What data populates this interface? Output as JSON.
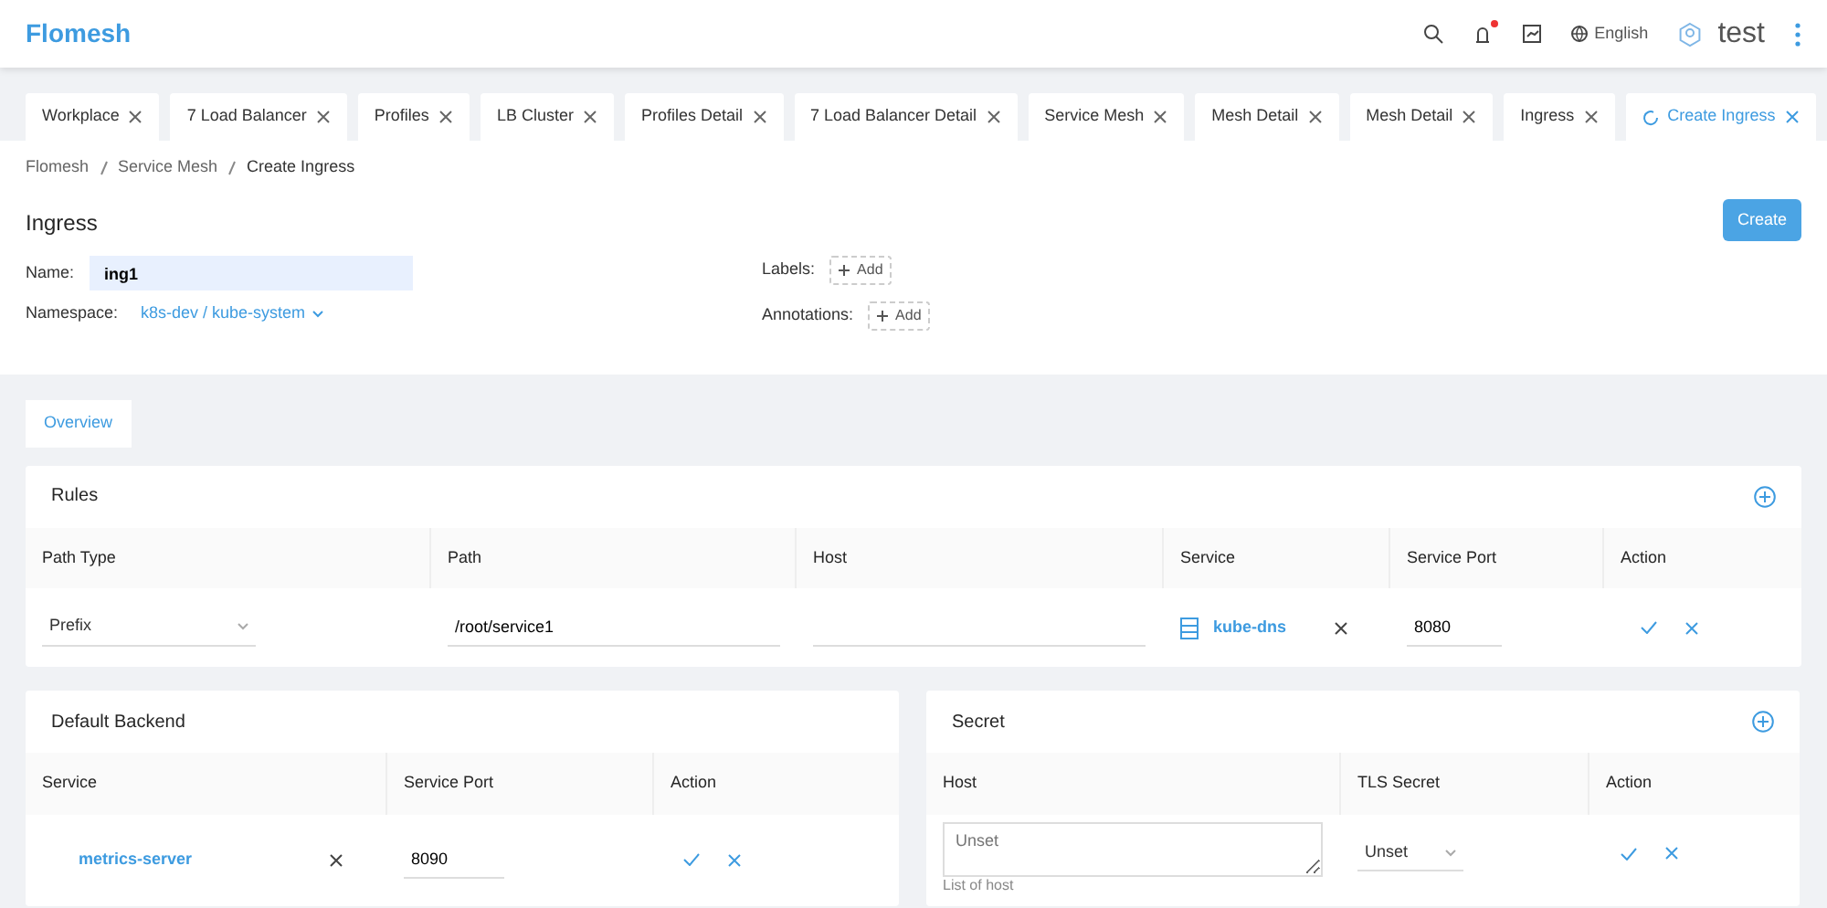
{
  "header": {
    "logo": "Flomesh",
    "has_notification": true,
    "language": "English",
    "user": "test"
  },
  "tabs": [
    {
      "label": "Workplace",
      "selected": false
    },
    {
      "label": "7 Load Balancer",
      "selected": false
    },
    {
      "label": "Profiles",
      "selected": false
    },
    {
      "label": "LB Cluster",
      "selected": false
    },
    {
      "label": "Profiles Detail",
      "selected": false
    },
    {
      "label": "7 Load Balancer Detail",
      "selected": false
    },
    {
      "label": "Service Mesh",
      "selected": false
    },
    {
      "label": "Mesh Detail",
      "selected": false
    },
    {
      "label": "Mesh Detail",
      "selected": false
    },
    {
      "label": "Ingress",
      "selected": false
    },
    {
      "label": "Create Ingress",
      "selected": true
    }
  ],
  "breadcrumb": [
    "Flomesh",
    "Service Mesh",
    "Create Ingress"
  ],
  "page": {
    "title": "Ingress",
    "create_button": "Create"
  },
  "form": {
    "name_label": "Name:",
    "name_value": "ing1",
    "namespace_label": "Namespace:",
    "namespace_value": "k8s-dev / kube-system",
    "labels_label": "Labels:",
    "labels_add": "Add",
    "annotations_label": "Annotations:",
    "annotations_add": "Add"
  },
  "section_tabs": [
    {
      "label": "Overview",
      "selected": true
    }
  ],
  "rules": {
    "title": "Rules",
    "columns": [
      "Path Type",
      "Path",
      "Host",
      "Service",
      "Service Port",
      "Action"
    ],
    "rows": [
      {
        "path_type": "Prefix",
        "path": "/root/service1",
        "service": "kube-dns",
        "service_port": "8080"
      }
    ]
  },
  "default_backend": {
    "title": "Default Backend",
    "columns": [
      "Service",
      "Service Port",
      "Action"
    ],
    "rows": [
      {
        "service": "metrics-server",
        "service_port": "8090"
      }
    ]
  },
  "secret": {
    "title": "Secret",
    "columns": [
      "Host",
      "TLS Secret",
      "Action"
    ],
    "rows": [
      {
        "host_placeholder": "Unset",
        "host_hint": "List of host",
        "tls_secret": "Unset"
      }
    ]
  }
}
